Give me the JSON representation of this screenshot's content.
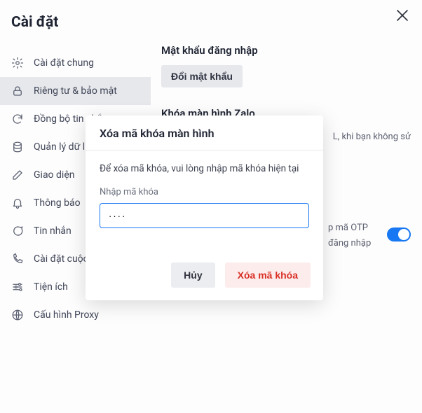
{
  "header": {
    "title": "Cài đặt"
  },
  "sidebar": {
    "items": [
      {
        "label": "Cài đặt chung",
        "icon": "gear-icon"
      },
      {
        "label": "Riêng tư & bảo mật",
        "icon": "lock-icon",
        "active": true
      },
      {
        "label": "Đồng bộ tin nhắn",
        "icon": "sync-icon"
      },
      {
        "label": "Quản lý dữ liệu",
        "icon": "database-icon"
      },
      {
        "label": "Giao diện",
        "icon": "pencil-icon"
      },
      {
        "label": "Thông báo",
        "icon": "bell-icon"
      },
      {
        "label": "Tin nhắn",
        "icon": "message-icon"
      },
      {
        "label": "Cài đặt cuộc gọi",
        "icon": "phone-icon"
      },
      {
        "label": "Tiện ích",
        "icon": "sliders-icon"
      },
      {
        "label": "Cấu hình Proxy",
        "icon": "globe-icon"
      }
    ]
  },
  "content": {
    "password_section_title": "Mật khẩu đăng nhập",
    "change_password_button": "Đổi mật khẩu",
    "lock_section_title": "Khóa màn hình Zalo",
    "lock_hint_fragment": "L, khi bạn không sử",
    "otp_line1": "p  mã  OTP",
    "otp_line2": "đăng nhập",
    "otp_enabled": true
  },
  "modal": {
    "title": "Xóa mã khóa màn hình",
    "description": "Để xóa mã khóa, vui lòng nhập mã khóa hiện tại",
    "input_label": "Nhập mã khóa",
    "input_value": "····",
    "cancel": "Hủy",
    "confirm": "Xóa mã khóa"
  },
  "colors": {
    "accent": "#1877f2",
    "danger_text": "#d93025",
    "danger_bg": "#fdecec"
  }
}
